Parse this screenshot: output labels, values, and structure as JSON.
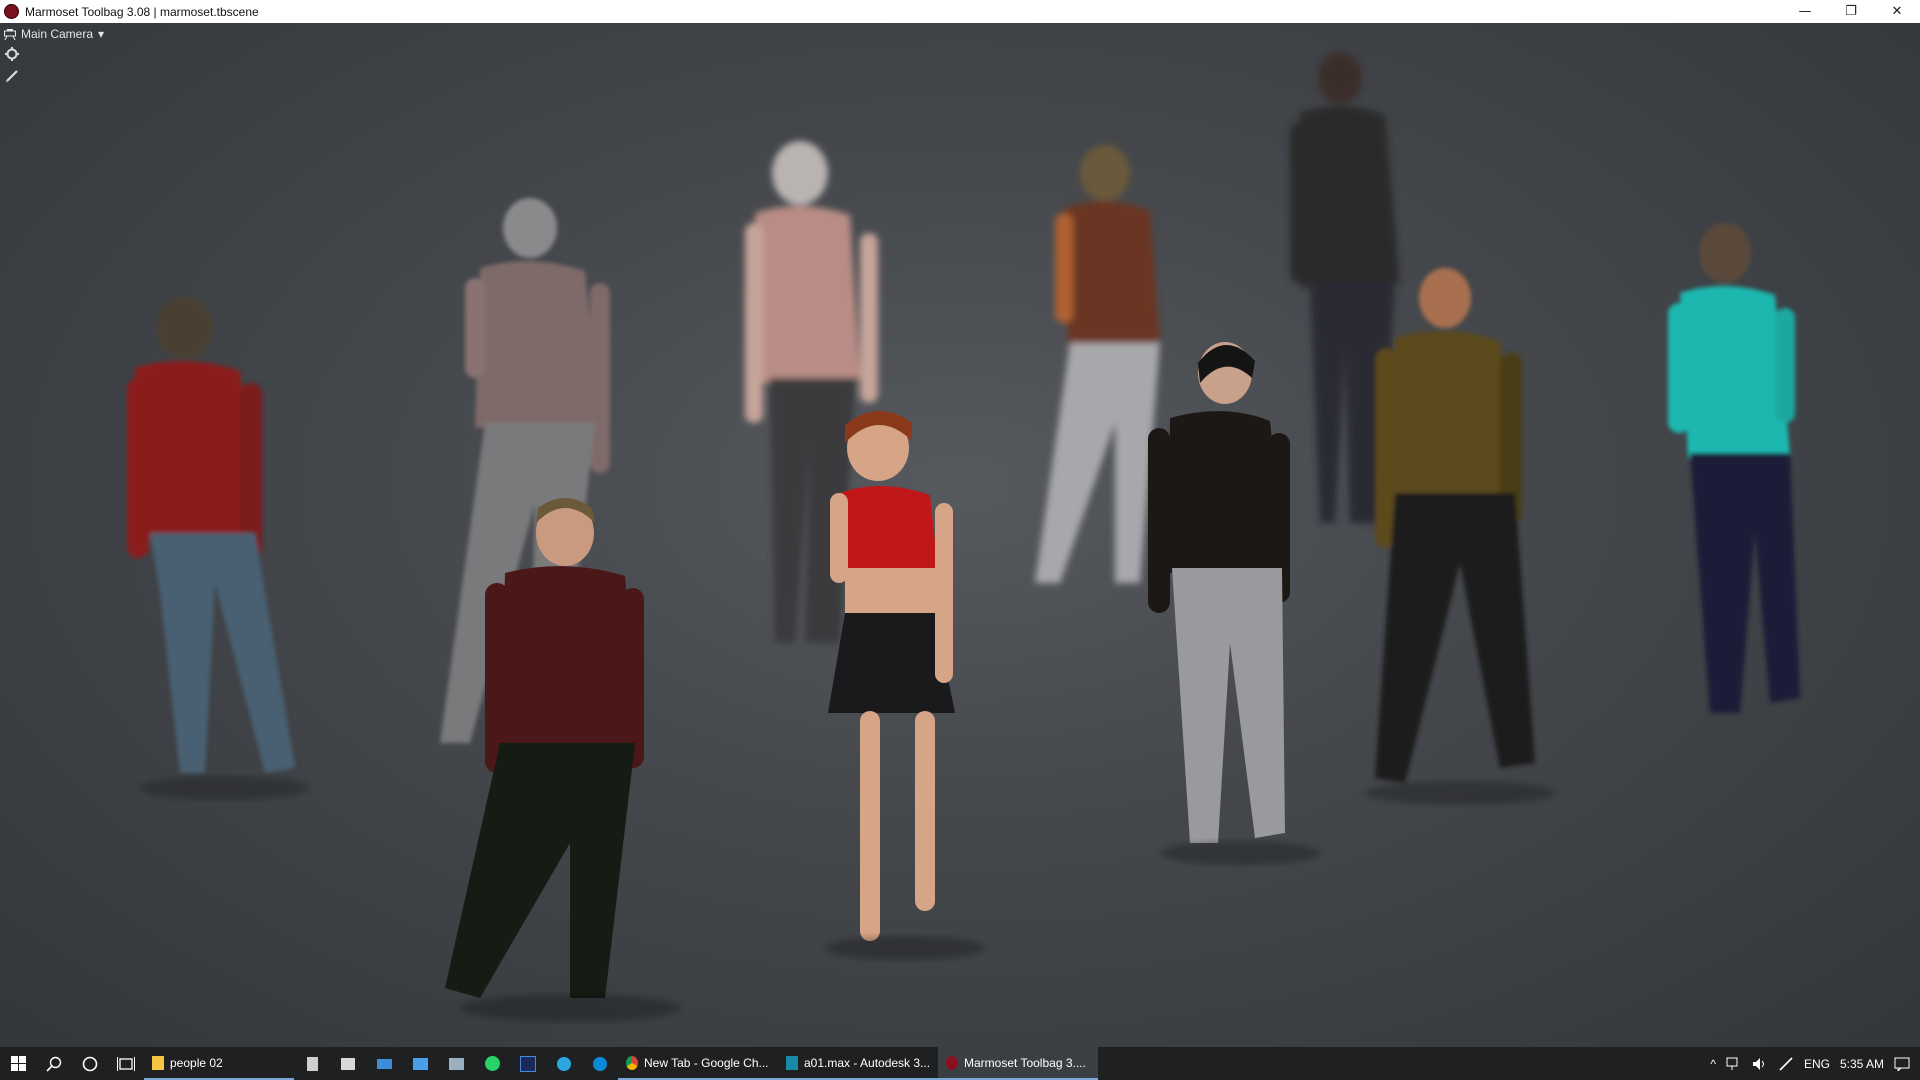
{
  "window": {
    "title": "Marmoset Toolbag 3.08  |  marmoset.tbscene",
    "minimize_glyph": "—",
    "restore_glyph": "❐",
    "close_glyph": "✕"
  },
  "viewport": {
    "camera_label": "Main Camera",
    "camera_dropdown_glyph": "▾"
  },
  "taskbar": {
    "tasks": [
      {
        "label": "people 02",
        "icon": "folder-icon"
      },
      {
        "label": "New Tab - Google Ch...",
        "icon": "chrome-icon"
      },
      {
        "label": "a01.max - Autodesk 3...",
        "icon": "3dsmax-icon"
      },
      {
        "label": "Marmoset Toolbag 3....",
        "icon": "marmoset-icon"
      }
    ],
    "tray": {
      "chevron": "^",
      "language": "ENG",
      "time": "5:35 AM"
    }
  },
  "colors": {
    "titlebar_bg": "#ffffff",
    "viewport_bg": "#45484c",
    "taskbar_bg": "#1e2022",
    "accent": "#7aa7d8"
  }
}
